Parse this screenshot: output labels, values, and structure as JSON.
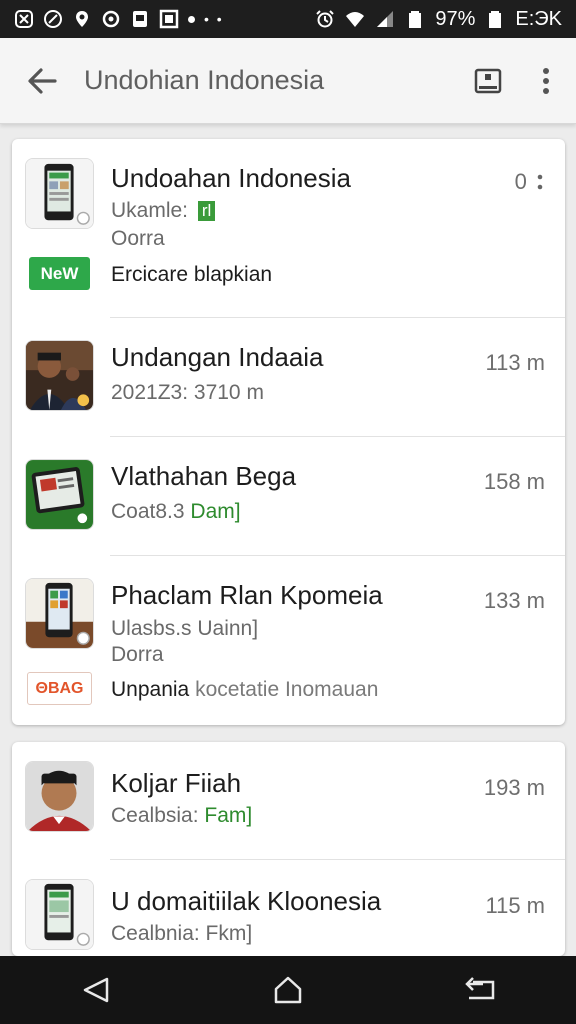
{
  "status_bar": {
    "battery": "97%",
    "time": "E:ЭK",
    "left_icons": [
      "notification-x-icon",
      "notification-slash-icon",
      "location-pin-icon",
      "notification-circle-icon",
      "notification-square-icon",
      "notification-box-icon"
    ],
    "right_icons": [
      "alarm-icon",
      "wifi-icon",
      "signal-icon",
      "battery-icon"
    ]
  },
  "app_bar": {
    "title": "Undohian Indonesia"
  },
  "cards": [
    {
      "items": [
        {
          "title": "Undoahan Indonesia",
          "meta_line1_prefix": "Ukamle:",
          "meta_line1_tag": "rl",
          "meta_line2": "Oorra",
          "distance": "0",
          "badge": "NeW",
          "badge_text": "Ercicare blapkian"
        },
        {
          "title": "Undangan Indaaia",
          "meta_line1_prefix": "2021Z3: 3710  m",
          "distance": "113 m"
        },
        {
          "title": "Vlathahan Bega",
          "meta_line1_prefix": "Coat8.3",
          "meta_line1_tag": "Dam]",
          "distance": "158 m"
        },
        {
          "title": "Phaclam Rlan Kpomeia",
          "meta_line1_prefix": "Ulasbs.s Uainn]",
          "meta_line2": "Dorra",
          "distance": "133 m",
          "badge": "ΘBAG",
          "badge_text_dark": "Unpania",
          "badge_text_light": "kocetatie Inomauan"
        }
      ]
    },
    {
      "items": [
        {
          "title": "Koljar Fiiah",
          "meta_line1_prefix": "Cealbsia:",
          "meta_line1_tag": "Fam]",
          "distance": "193 m"
        },
        {
          "title": "U domaitiilak Kloonesia",
          "meta_line1_prefix": "Cealbnia: Fkm]",
          "distance": "115 m"
        }
      ]
    }
  ],
  "colors": {
    "green_accent": "#2ea84a",
    "orange_badge": "#e2552b",
    "status_bar": "#1e1e1e",
    "nav_bar": "#141414"
  },
  "nav_bar": {
    "buttons": [
      "back-triangle-icon",
      "home-icon",
      "recents-icon"
    ]
  }
}
